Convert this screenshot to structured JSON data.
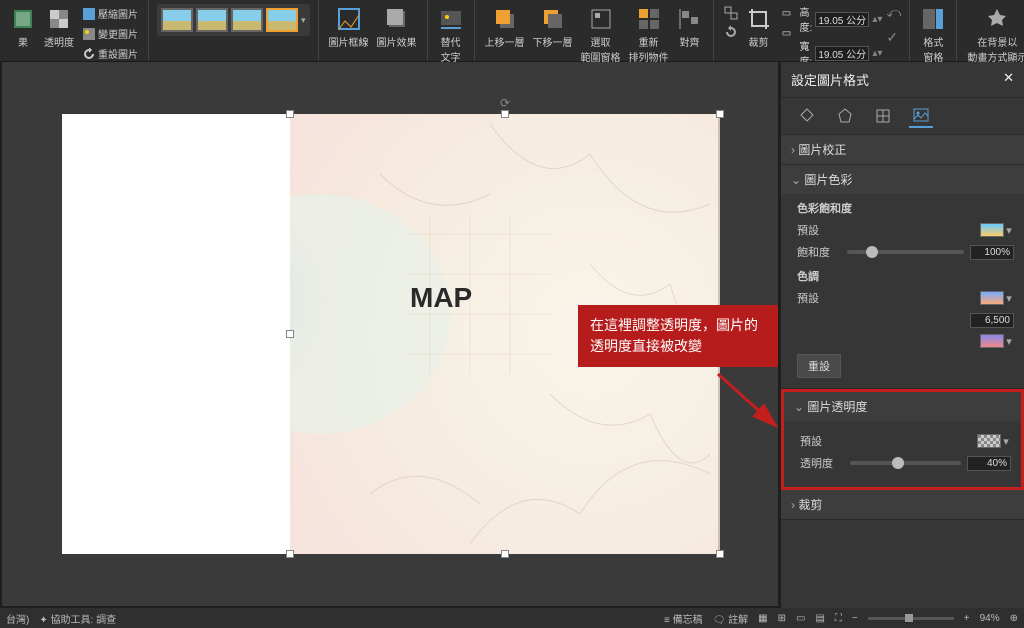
{
  "ribbon": {
    "left": {
      "compress": "壓縮圖片",
      "change": "變更圖片",
      "reset": "重設圖片",
      "result": "果",
      "transparency": "透明度"
    },
    "border": "圖片框線",
    "effect": "圖片效果",
    "alttext": "替代\n文字",
    "forward": "上移一層",
    "backward": "下移一層",
    "selpane": "選取\n範圍窗格",
    "align": "重新\n排列物件",
    "alignbtn": "對齊",
    "crop": "裁剪",
    "height_lbl": "高度:",
    "width_lbl": "寬度:",
    "height_val": "19.05 公分",
    "width_val": "19.05 公分",
    "fmtpane": "格式\n窗格",
    "anim": "在背景以\n動畫方式顯示"
  },
  "slide": {
    "map_text": "MAP"
  },
  "callout": {
    "text": "在這裡調整透明度，圖片的透明度直接被改變"
  },
  "pane": {
    "title": "設定圖片格式",
    "sec_correction": "圖片校正",
    "sec_color": "圖片色彩",
    "saturation_head": "色彩飽和度",
    "preset": "預設",
    "saturation": "飽和度",
    "saturation_val": "100%",
    "tone_head": "色調",
    "temperature_val": "6,500",
    "reset": "重設",
    "sec_transparency": "圖片透明度",
    "transparency": "透明度",
    "transparency_val": "40%",
    "sec_crop": "裁剪"
  },
  "status": {
    "lang": "台灣)",
    "access": "協助工具: 調查",
    "notes": "備忘稿",
    "comments": "註解",
    "zoom": "94%"
  }
}
